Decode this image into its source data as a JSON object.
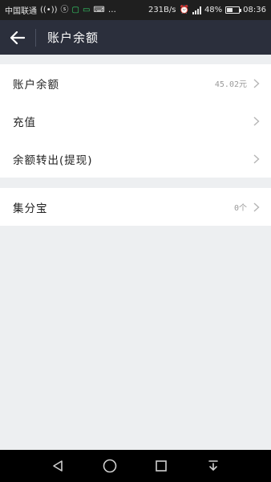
{
  "status_bar": {
    "carrier": "中国联通",
    "speed": "231B/s",
    "battery": "48%",
    "battery_level": 0.48,
    "time": "08:36"
  },
  "header": {
    "title": "账户余额"
  },
  "group1": {
    "items": [
      {
        "label": "账户余额",
        "value": "45.02元"
      },
      {
        "label": "充值",
        "value": ""
      },
      {
        "label": "余额转出(提现)",
        "value": ""
      }
    ]
  },
  "group2": {
    "items": [
      {
        "label": "集分宝",
        "value": "0个"
      }
    ]
  }
}
